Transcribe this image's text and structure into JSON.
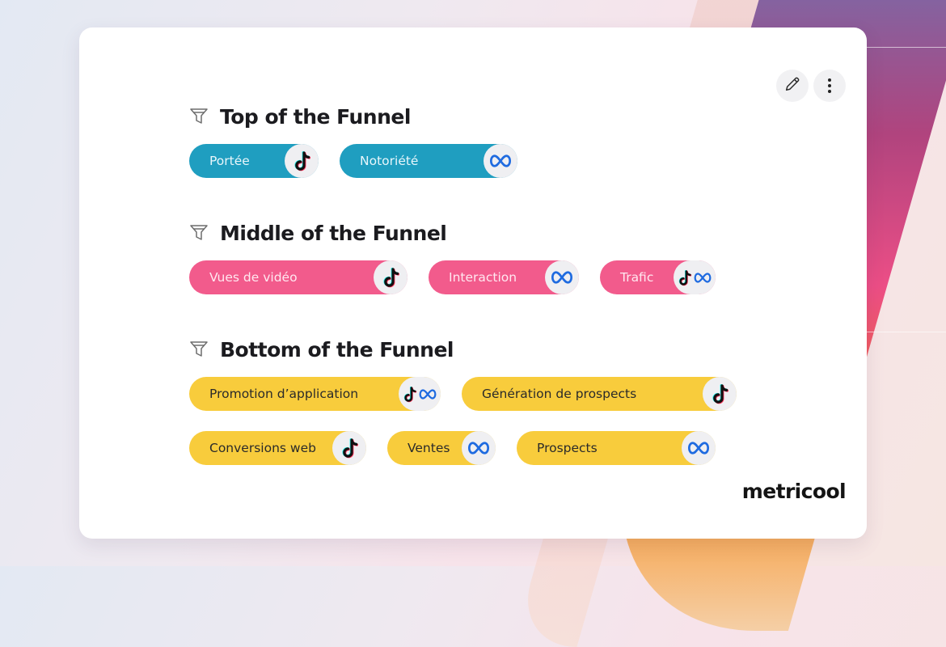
{
  "colors": {
    "top": "#1f9ec0",
    "middle": "#f25b8c",
    "bottom": "#f8cc3c"
  },
  "actions": {
    "edit_icon": "pencil-icon",
    "more_icon": "more-vertical-icon"
  },
  "sections": [
    {
      "title": "Top of the Funnel",
      "pills": [
        {
          "label": "Portée",
          "platforms": [
            "tiktok"
          ]
        },
        {
          "label": "Notoriété",
          "platforms": [
            "meta"
          ]
        }
      ]
    },
    {
      "title": "Middle of the Funnel",
      "pills": [
        {
          "label": "Vues de vidéo",
          "platforms": [
            "tiktok"
          ]
        },
        {
          "label": "Interaction",
          "platforms": [
            "meta"
          ]
        },
        {
          "label": "Trafic",
          "platforms": [
            "tiktok",
            "meta"
          ]
        }
      ]
    },
    {
      "title": "Bottom of the Funnel",
      "pills": [
        {
          "label": "Promotion d’application",
          "platforms": [
            "tiktok",
            "meta"
          ]
        },
        {
          "label": "Génération de prospects",
          "platforms": [
            "tiktok"
          ]
        },
        {
          "label": "Conversions web",
          "platforms": [
            "tiktok"
          ]
        },
        {
          "label": "Ventes",
          "platforms": [
            "meta"
          ]
        },
        {
          "label": "Prospects",
          "platforms": [
            "meta"
          ]
        }
      ]
    }
  ],
  "brand": "metricool"
}
